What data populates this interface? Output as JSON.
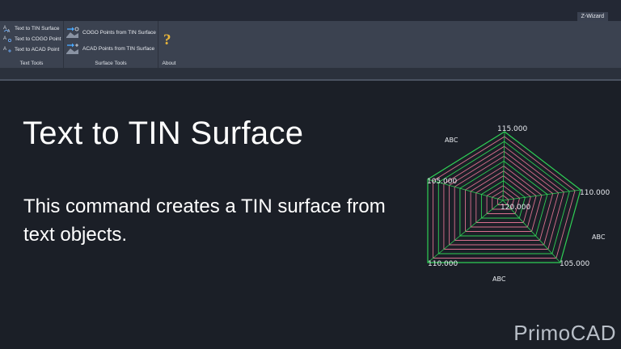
{
  "ribbon": {
    "tab_label": "Z-Wizard",
    "panels": {
      "text_tools": {
        "title": "Text Tools",
        "buttons": [
          "Text to TIN Surface",
          "Text to COGO Point",
          "Text to ACAD Point"
        ]
      },
      "surface_tools": {
        "title": "Surface Tools",
        "buttons": [
          "COGO Points from TIN Surface",
          "ACAD Points from TIN Surface"
        ]
      },
      "about": {
        "title": "About",
        "icon": "question-mark-icon"
      }
    }
  },
  "slide": {
    "title": "Text to TIN Surface",
    "description": "This command creates a TIN surface from text objects."
  },
  "illustration": {
    "labels": {
      "top": "115.000",
      "right": "110.000",
      "bottom_right": "105.000",
      "bottom_left": "110.000",
      "left": "105.000",
      "center": "120.000",
      "abc_top_left": "ABC",
      "abc_right": "ABC",
      "abc_bottom": "ABC"
    },
    "colors": {
      "boundary": "#2fcf55",
      "contour": "#d9708e",
      "text": "#e8ebf0"
    }
  },
  "brand": {
    "name": "PrimoCAD"
  }
}
